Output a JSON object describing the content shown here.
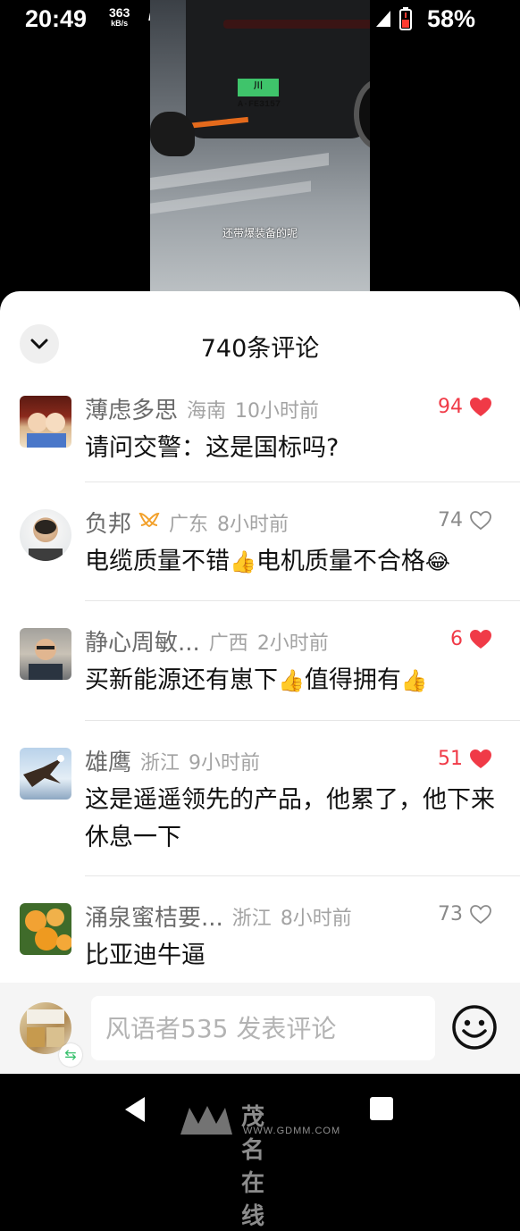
{
  "status_bar": {
    "time": "20:49",
    "net_speed": "363",
    "net_unit": "kB/s",
    "hd": "HD",
    "battery": "58%"
  },
  "video": {
    "plate": "川A·FE3157",
    "subtitle": "还带爆装备的呢"
  },
  "sheet": {
    "title": "740条评论"
  },
  "comments": [
    {
      "name": "薄虑多思",
      "location": "海南",
      "time": "10小时前",
      "text": "请问交警：这是国标吗?",
      "likes": "94",
      "liked": true
    },
    {
      "name": "负邦",
      "location": "广东",
      "time": "8小时前",
      "text": "电缆质量不错",
      "text_b": "电机质量不合格",
      "likes": "74",
      "liked": false
    },
    {
      "name": "静心周敏...",
      "location": "广西",
      "time": "2小时前",
      "text": "买新能源还有崽下",
      "text_b": "值得拥有",
      "likes": "6",
      "liked": true
    },
    {
      "name": "雄鹰",
      "location": "浙江",
      "time": "9小时前",
      "text": "这是遥遥领先的产品，他累了，他下来休息一下",
      "likes": "51",
      "liked": true
    },
    {
      "name": "涌泉蜜桔要...",
      "location": "浙江",
      "time": "8小时前",
      "text": "比亚迪牛逼",
      "likes": "73",
      "liked": false
    }
  ],
  "input": {
    "placeholder": "风语者535 发表评论"
  },
  "watermark": {
    "cn": "茂名在线",
    "en": "WWW.GDMM.COM"
  },
  "colors": {
    "like_active": "#f03a47",
    "like_inactive": "#8a8a8a",
    "badge": "#f2a12c"
  }
}
